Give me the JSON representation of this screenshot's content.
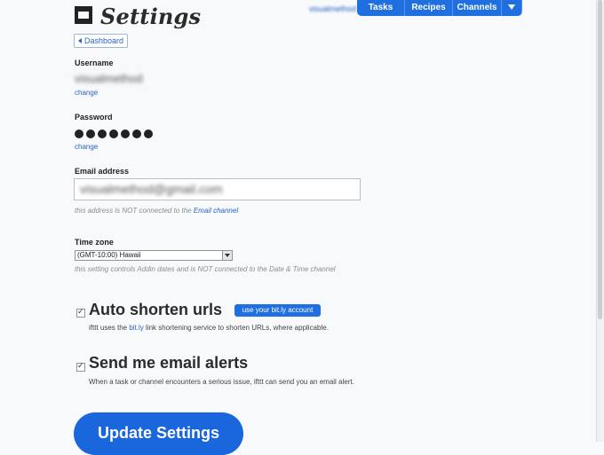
{
  "header": {
    "title": "Settings",
    "username_link": "visualmethod",
    "nav": [
      {
        "label": "Tasks"
      },
      {
        "label": "Recipes"
      },
      {
        "label": "Channels"
      }
    ]
  },
  "dashboard_button": "Dashboard",
  "username": {
    "label": "Username",
    "value": "visualmethod",
    "change": "change"
  },
  "password": {
    "label": "Password",
    "change": "change"
  },
  "email": {
    "label": "Email address",
    "value": "visualmethod@gmail.com",
    "hint_prefix": "this address is NOT connected to the ",
    "hint_link": "Email channel"
  },
  "timezone": {
    "label": "Time zone",
    "selected": "(GMT-10:00) Hawaii",
    "hint": "this setting controls Addin dates and is NOT connected to the Date & Time channel"
  },
  "auto_shorten": {
    "checked": true,
    "title": "Auto shorten urls",
    "button": "use your bit.ly account",
    "desc_prefix": "ifttt uses the ",
    "desc_link": "bit.ly",
    "desc_suffix": " link shortening service to shorten URLs, where applicable."
  },
  "email_alerts": {
    "checked": true,
    "title": "Send me email alerts",
    "desc": "When a task or channel encounters a serious issue, ifttt can send you an email alert."
  },
  "submit": "Update Settings",
  "colors": {
    "accent": "#1f6fe0",
    "link": "#2a63c7"
  }
}
